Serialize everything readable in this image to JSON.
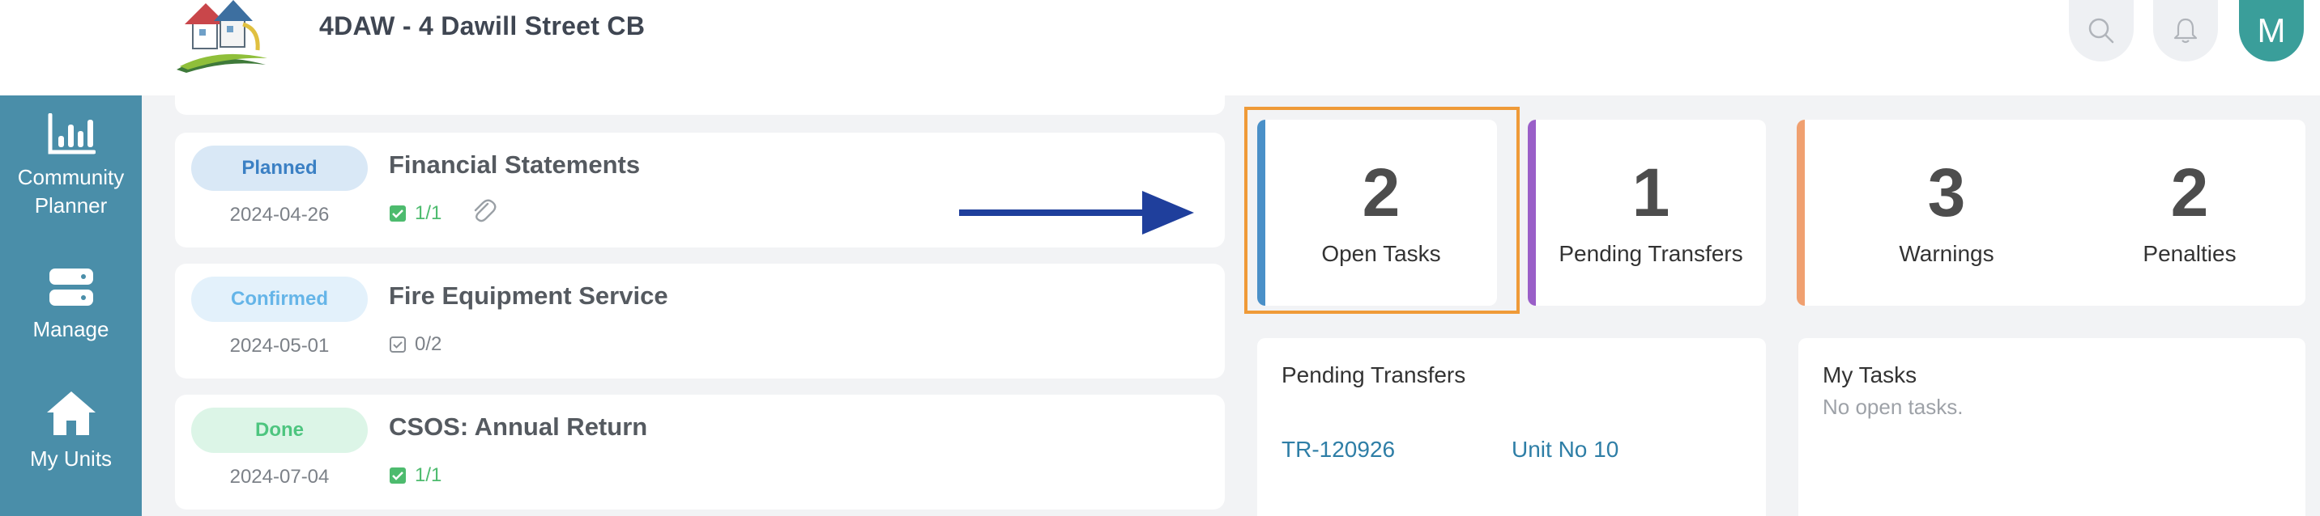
{
  "header": {
    "title": "4DAW - 4 Dawill Street CB",
    "search_icon": "search-icon",
    "notification_icon": "bell-icon",
    "avatar_initial": "M"
  },
  "sidebar": {
    "items": [
      {
        "label": "Community Planner",
        "icon": "bar-chart-icon"
      },
      {
        "label": "Manage",
        "icon": "server-icon"
      },
      {
        "label": "My Units",
        "icon": "home-icon"
      }
    ]
  },
  "tasks": [
    {
      "status": "Planned",
      "title": "Financial Statements",
      "date": "2024-04-26",
      "checklist": "1/1",
      "has_attachment": true
    },
    {
      "status": "Confirmed",
      "title": "Fire Equipment Service",
      "date": "2024-05-01",
      "checklist": "0/2",
      "has_attachment": false
    },
    {
      "status": "Done",
      "title": "CSOS: Annual Return",
      "date": "2024-07-04",
      "checklist": "1/1",
      "has_attachment": false
    }
  ],
  "stats": {
    "open_tasks": {
      "value": "2",
      "label": "Open Tasks"
    },
    "pending_transfers": {
      "value": "1",
      "label": "Pending Transfers"
    },
    "warnings": {
      "value": "3",
      "label": "Warnings"
    },
    "penalties": {
      "value": "2",
      "label": "Penalties"
    }
  },
  "pending_transfers_panel": {
    "title": "Pending Transfers",
    "transfer_id": "TR-120926",
    "unit": "Unit No 10"
  },
  "my_tasks_panel": {
    "title": "My Tasks",
    "empty_text": "No open tasks."
  },
  "colors": {
    "sidebar": "#4a8ea9",
    "avatar": "#3a9e9a",
    "highlight": "#ef9a38",
    "arrow": "#1f3f9c",
    "open_tasks_accent": "#4a90c8",
    "pending_transfers_accent": "#9a5fc8",
    "warnings_accent": "#f0a070"
  }
}
